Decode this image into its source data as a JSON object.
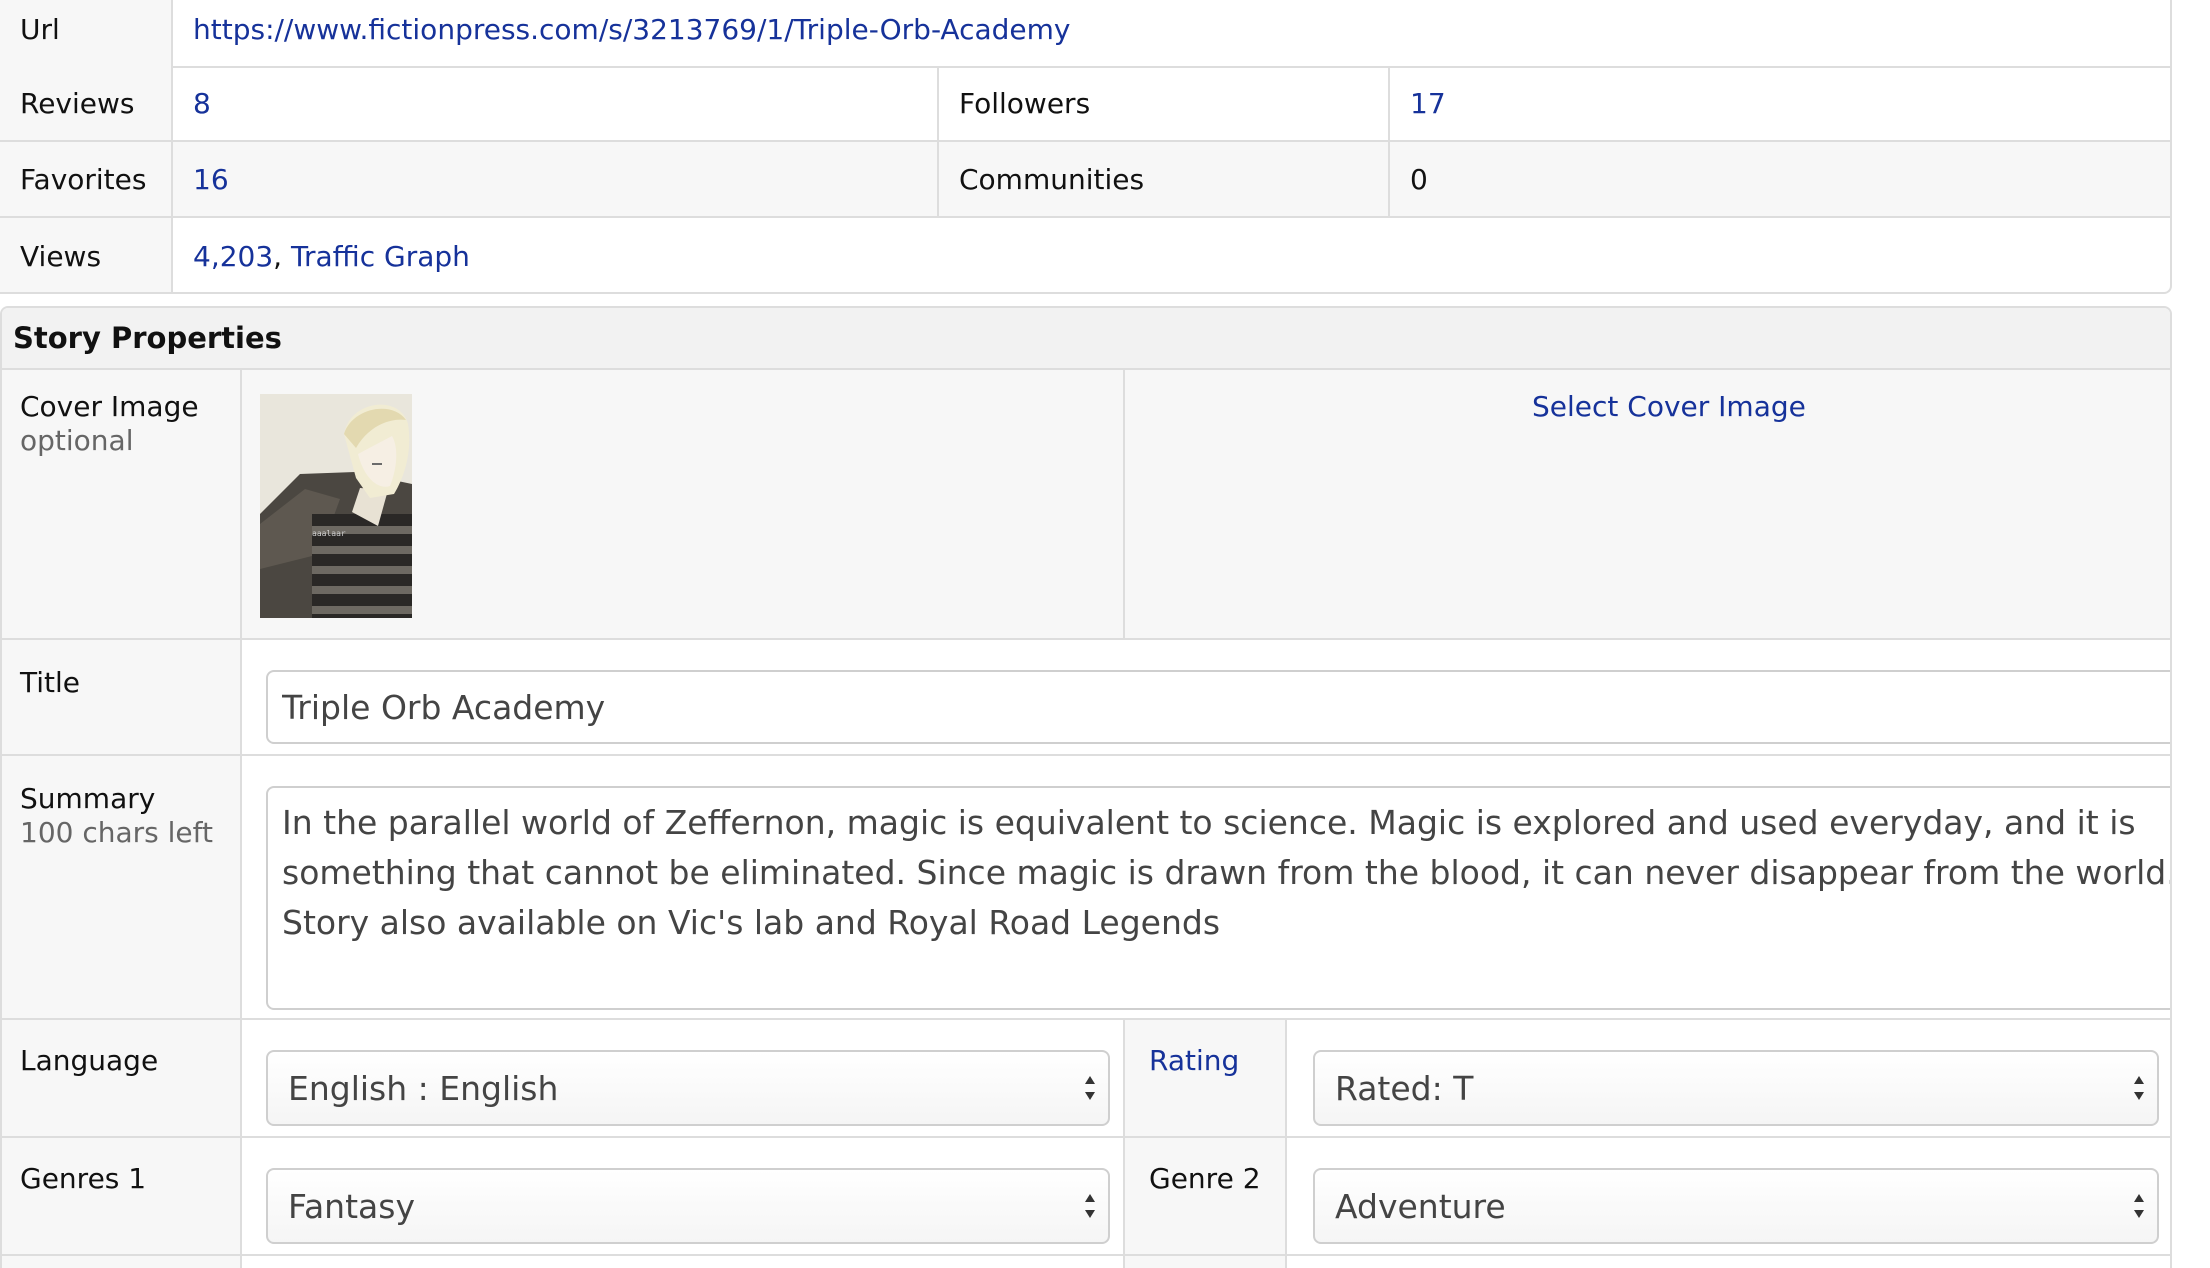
{
  "stats": {
    "url_label": "Url",
    "url_value": "https://www.fictionpress.com/s/3213769/1/Triple-Orb-Academy",
    "reviews_label": "Reviews",
    "reviews_value": "8",
    "followers_label": "Followers",
    "followers_value": "17",
    "favorites_label": "Favorites",
    "favorites_value": "16",
    "communities_label": "Communities",
    "communities_value": "0",
    "views_label": "Views",
    "views_value": "4,203",
    "views_separator": ",",
    "traffic_graph_link": "Traffic Graph"
  },
  "properties": {
    "heading": "Story Properties",
    "cover_label": "Cover Image",
    "cover_hint": "optional",
    "select_cover_link": "Select Cover Image",
    "cover_watermark": "aaalaar",
    "title_label": "Title",
    "title_value": "Triple Orb Academy",
    "summary_label": "Summary",
    "summary_hint": "100 chars left",
    "summary_value": "In the parallel world of Zeffernon, magic is equivalent to science. Magic is explored and used everyday, and it is something that cannot be eliminated. Since magic is drawn from the blood, it can never disappear from the world. Story also available on Vic's lab and Royal Road Legends",
    "language_label": "Language",
    "language_value": "English : English",
    "rating_label": "Rating",
    "rating_value": "Rated: T",
    "genre1_label": "Genres 1",
    "genre1_value": "Fantasy",
    "genre2_label": "Genre 2",
    "genre2_value": "Adventure"
  },
  "colors": {
    "link": "#16329a",
    "border": "#dddddd",
    "label_bg": "#f7f7f7",
    "header_bg": "#f2f2f2"
  }
}
